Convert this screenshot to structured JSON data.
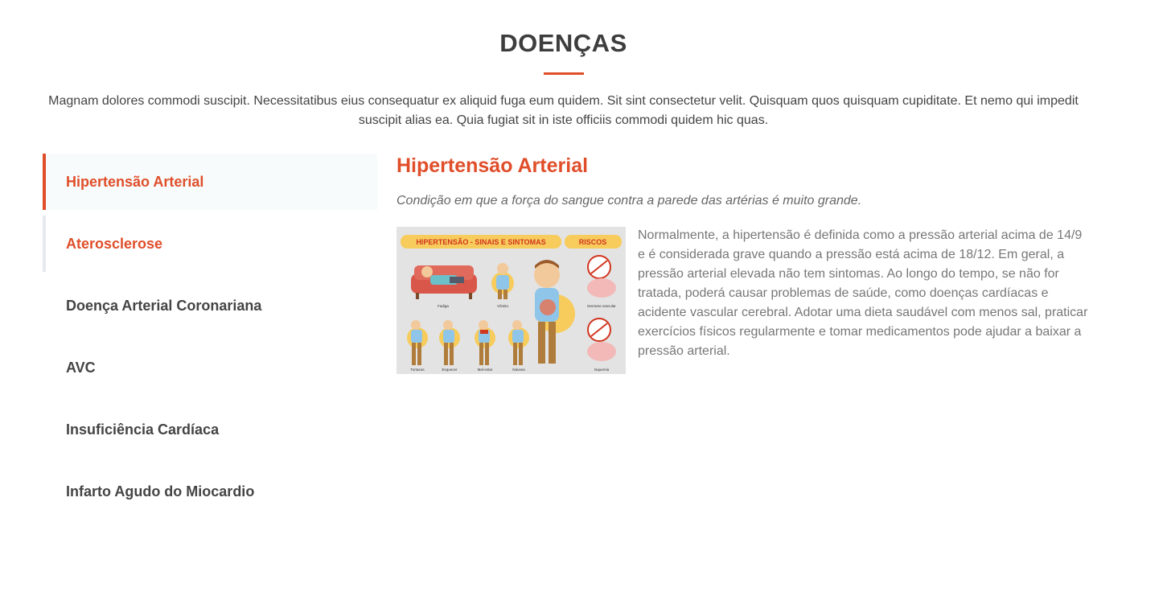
{
  "section": {
    "title": "DOENÇAS",
    "intro": "Magnam dolores commodi suscipit. Necessitatibus eius consequatur ex aliquid fuga eum quidem. Sit sint consectetur velit. Quisquam quos quisquam cupiditate. Et nemo qui impedit suscipit alias ea. Quia fugiat sit in iste officiis commodi quidem hic quas."
  },
  "tabs": [
    {
      "label": "Hipertensão Arterial",
      "state": "active"
    },
    {
      "label": "Aterosclerose",
      "state": "hover"
    },
    {
      "label": "Doença Arterial Coronariana",
      "state": "normal"
    },
    {
      "label": "AVC",
      "state": "normal"
    },
    {
      "label": "Insuficiência Cardíaca",
      "state": "normal"
    },
    {
      "label": "Infarto Agudo do Miocardio",
      "state": "normal"
    }
  ],
  "content": {
    "title": "Hipertensão Arterial",
    "subtitle": "Condição em que a força do sangue contra a parede das artérias é muito grande.",
    "body": "Normalmente, a hipertensão é definida como a pressão arterial acima de 14/9 e é considerada grave quando a pressão está acima de 18/12. Em geral, a pressão arterial elevada não tem sintomas. Ao longo do tempo, se não for tratada, poderá causar problemas de saúde, como doenças cardíacas e acidente vascular cerebral. Adotar uma dieta saudável com menos sal, praticar exercícios físicos regularmente e tomar medicamentos pode ajudar a baixar a pressão arterial.",
    "figure": {
      "banner_left": "HIPERTENSÃO - SINAIS E SINTOMAS",
      "banner_right": "RISCOS",
      "captions": [
        "Fadiga",
        "Vômito",
        "Derrame vascular",
        "Tonturas",
        "Esquecer",
        "Mal-estar",
        "Náusea",
        "Isquemia"
      ]
    }
  },
  "colors": {
    "accent": "#e04e2a",
    "active_tab_bg": "#f7fbfb",
    "heading": "#3d3d3d",
    "body_text": "#777777"
  }
}
